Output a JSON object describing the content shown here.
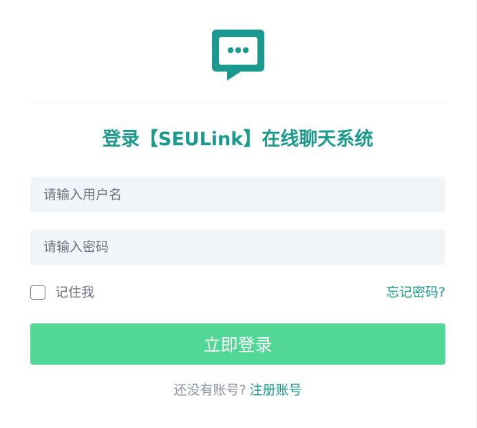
{
  "logo": {
    "icon": "chat-bubble-icon",
    "color": "#1a9a8e"
  },
  "title": "登录【SEULink】在线聊天系统",
  "form": {
    "username_placeholder": "请输入用户名",
    "password_placeholder": "请输入密码",
    "remember_label": "记住我",
    "remember_checked": false,
    "forgot_label": "忘记密码?",
    "submit_label": "立即登录"
  },
  "signup": {
    "prompt": "还没有账号?",
    "link_label": "注册账号"
  },
  "colors": {
    "accent": "#1a9a8e",
    "button": "#52d896",
    "input_bg": "#f1f4f8"
  }
}
